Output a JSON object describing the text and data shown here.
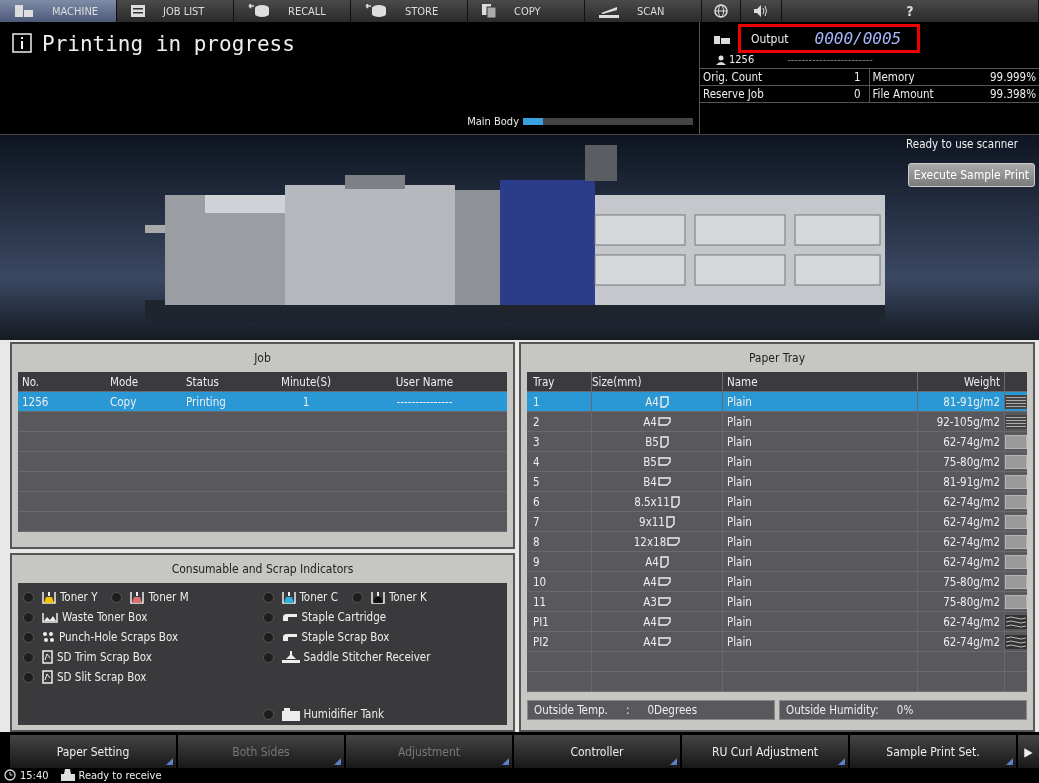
{
  "tabs": [
    {
      "kind": "machine",
      "label": "MACHINE",
      "selected": true
    },
    {
      "kind": "list",
      "label": "JOB LIST",
      "selected": false
    },
    {
      "kind": "recall",
      "label": "RECALL",
      "selected": false
    },
    {
      "kind": "store",
      "label": "STORE",
      "selected": false
    },
    {
      "kind": "copy",
      "label": "COPY",
      "selected": false
    },
    {
      "kind": "scan",
      "label": "SCAN",
      "selected": false
    },
    {
      "kind": "globe",
      "selected": false
    },
    {
      "kind": "speaker",
      "selected": false
    },
    {
      "kind": "help",
      "label": "?",
      "selected": false
    }
  ],
  "header": {
    "title": "Printing in progress",
    "progress": {
      "label": "Main Body",
      "level": 0.12
    },
    "output": {
      "label": "Output",
      "value": "0000/0005"
    },
    "user": {
      "id": "1256",
      "name": "------------------------"
    },
    "counters": [
      {
        "label": "Orig. Count",
        "value": "1"
      },
      {
        "label": "Memory",
        "value": "99.999%"
      },
      {
        "label": "Reserve Job",
        "value": "0"
      },
      {
        "label": "File Amount",
        "value": "99.398%"
      }
    ],
    "scanner_status": "Ready to use scanner",
    "sample_button": "Execute Sample Print"
  },
  "job": {
    "title": "Job",
    "columns": [
      "No.",
      "Mode",
      "Status",
      "Minute(S)",
      "User Name"
    ],
    "rows": [
      {
        "cells": [
          "1256",
          "Copy",
          "Printing",
          "1",
          "---------------"
        ],
        "selected": true
      }
    ]
  },
  "consumables": {
    "title": "Consumable and Scrap Indicators",
    "left": [
      [
        {
          "kind": "toner",
          "label": "Toner Y",
          "color": "#f2c500"
        },
        {
          "kind": "toner",
          "label": "Toner M",
          "color": "#e07070"
        }
      ],
      [
        {
          "kind": "waste",
          "label": "Waste Toner Box"
        }
      ],
      [
        {
          "kind": "punch",
          "label": "Punch-Hole Scraps Box"
        }
      ],
      [
        {
          "kind": "trim",
          "label": "SD Trim Scrap Box"
        }
      ],
      [
        {
          "kind": "trim",
          "label": "SD Slit Scrap Box"
        }
      ]
    ],
    "right": [
      [
        {
          "kind": "toner",
          "label": "Toner C",
          "color": "#30b0e0"
        },
        {
          "kind": "toner",
          "label": "Toner K",
          "color": "#111111"
        }
      ],
      [
        {
          "kind": "staple",
          "label": "Staple Cartridge"
        }
      ],
      [
        {
          "kind": "staple",
          "label": "Staple Scrap Box"
        }
      ],
      [
        {
          "kind": "saddle",
          "label": "Saddle Stitcher Receiver"
        }
      ]
    ],
    "bottom": {
      "kind": "tank",
      "label": "Humidifier Tank"
    }
  },
  "tray": {
    "title": "Paper Tray",
    "columns": [
      "Tray",
      "Size(mm)",
      "Name",
      "Weight"
    ],
    "rows": [
      {
        "tray": "1",
        "size": {
          "text": "A4",
          "kind": "portrait"
        },
        "name": "Plain",
        "weight": "81-91g/m2",
        "kind": "lines",
        "selected": true
      },
      {
        "tray": "2",
        "size": {
          "text": "A4",
          "kind": "landscape"
        },
        "name": "Plain",
        "weight": "92-105g/m2",
        "kind": "lines",
        "selected": false
      },
      {
        "tray": "3",
        "size": {
          "text": "B5",
          "kind": "portrait"
        },
        "name": "Plain",
        "weight": "62-74g/m2",
        "kind": "block",
        "selected": false
      },
      {
        "tray": "4",
        "size": {
          "text": "B5",
          "kind": "landscape"
        },
        "name": "Plain",
        "weight": "75-80g/m2",
        "kind": "block",
        "selected": false
      },
      {
        "tray": "5",
        "size": {
          "text": "B4",
          "kind": "landscape"
        },
        "name": "Plain",
        "weight": "81-91g/m2",
        "kind": "block",
        "selected": false
      },
      {
        "tray": "6",
        "size": {
          "text": "8.5x11",
          "kind": "portrait"
        },
        "name": "Plain",
        "weight": "62-74g/m2",
        "kind": "block",
        "selected": false
      },
      {
        "tray": "7",
        "size": {
          "text": "9x11",
          "kind": "portrait"
        },
        "name": "Plain",
        "weight": "62-74g/m2",
        "kind": "block",
        "selected": false
      },
      {
        "tray": "8",
        "size": {
          "text": "12x18",
          "kind": "landscape"
        },
        "name": "Plain",
        "weight": "62-74g/m2",
        "kind": "block",
        "selected": false
      },
      {
        "tray": "9",
        "size": {
          "text": "A4",
          "kind": "portrait"
        },
        "name": "Plain",
        "weight": "62-74g/m2",
        "kind": "block",
        "selected": false
      },
      {
        "tray": "10",
        "size": {
          "text": "A4",
          "kind": "landscape"
        },
        "name": "Plain",
        "weight": "75-80g/m2",
        "kind": "block",
        "selected": false
      },
      {
        "tray": "11",
        "size": {
          "text": "A3",
          "kind": "landscape"
        },
        "name": "Plain",
        "weight": "75-80g/m2",
        "kind": "block",
        "selected": false
      },
      {
        "tray": "PI1",
        "size": {
          "text": "A4",
          "kind": "landscape"
        },
        "name": "Plain",
        "weight": "62-74g/m2",
        "kind": "wave",
        "selected": false
      },
      {
        "tray": "PI2",
        "size": {
          "text": "A4",
          "kind": "landscape"
        },
        "name": "Plain",
        "weight": "62-74g/m2",
        "kind": "wave",
        "selected": false
      }
    ],
    "footer": {
      "temp_label": "Outside Temp.",
      "temp_sep": ":",
      "temp_value": "0Degrees",
      "humidity_label": "Outside Humidity:",
      "humidity_value": "0%"
    }
  },
  "buttons": [
    {
      "kind": "menu",
      "label": "Paper Setting",
      "disabled": false
    },
    {
      "kind": "menu",
      "label": "Both Sides",
      "disabled": true
    },
    {
      "kind": "menu",
      "label": "Adjustment",
      "disabled": true
    },
    {
      "kind": "menu",
      "label": "Controller",
      "disabled": false
    },
    {
      "kind": "menu",
      "label": "RU Curl Adjustment",
      "disabled": false
    },
    {
      "kind": "menu",
      "label": "Sample Print Set.",
      "disabled": false
    },
    {
      "kind": "next",
      "label": "▶",
      "disabled": false
    }
  ],
  "status": {
    "time": "15:40",
    "message": "Ready to receive"
  }
}
